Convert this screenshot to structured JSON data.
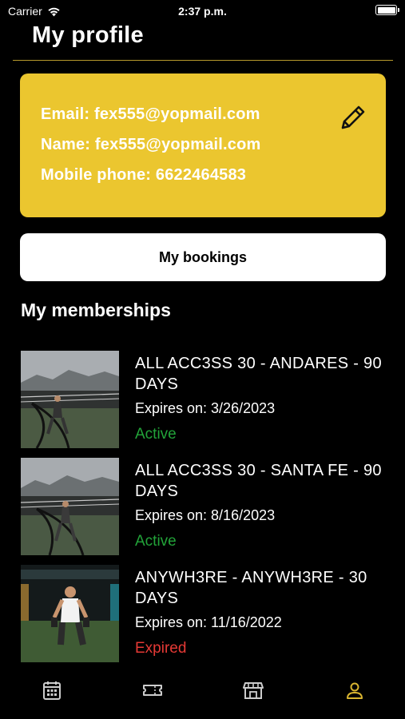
{
  "status_bar": {
    "carrier": "Carrier",
    "time": "2:37 p.m."
  },
  "page": {
    "title": "My profile"
  },
  "profile": {
    "email_line": "Email: fex555@yopmail.com",
    "name_line": "Name: fex555@yopmail.com",
    "phone_line": "Mobile phone: 6622464583",
    "edit_icon": "pencil-icon"
  },
  "bookings_button": {
    "label": "My bookings"
  },
  "memberships": {
    "title": "My memberships",
    "items": [
      {
        "name": "ALL ACC3SS 30 - ANDARES - 90 DAYS",
        "expires": "Expires on: 3/26/2023",
        "status": "Active"
      },
      {
        "name": "ALL ACC3SS 30 - SANTA FE - 90 DAYS",
        "expires": "Expires on: 8/16/2023",
        "status": "Active"
      },
      {
        "name": "ANYWH3RE - ANYWH3RE - 30 DAYS",
        "expires": "Expires on: 11/16/2022",
        "status": "Expired"
      }
    ]
  },
  "tab_bar": {
    "tabs": [
      {
        "icon": "calendar-icon",
        "active": false
      },
      {
        "icon": "ticket-icon",
        "active": false
      },
      {
        "icon": "store-icon",
        "active": false
      },
      {
        "icon": "person-icon",
        "active": true
      }
    ]
  },
  "colors": {
    "accent": "#ebc62f",
    "active_tab": "#d8b430",
    "active_status": "#22a339",
    "expired_status": "#e53935"
  }
}
